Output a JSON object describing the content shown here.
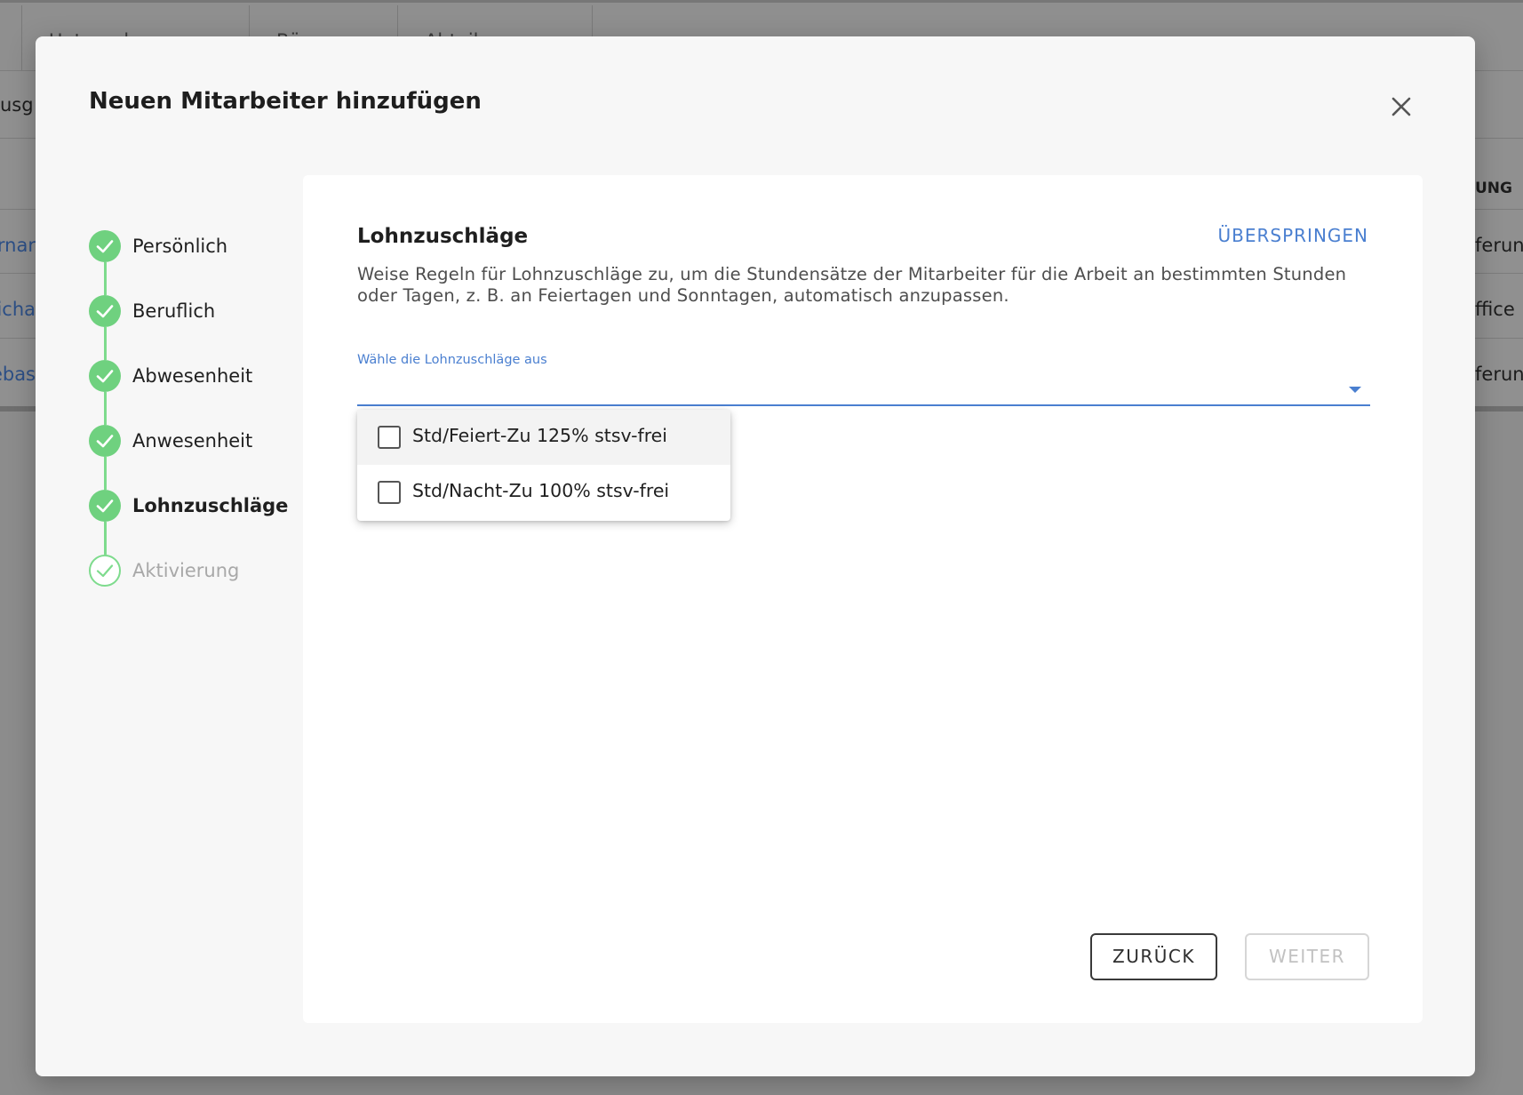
{
  "background": {
    "filters": [
      "Unternehmen",
      "Büro",
      "Abteilung"
    ],
    "left_fragments": [
      "usg",
      "rnar",
      "icha",
      "ebas"
    ],
    "right_fragments": [
      "UNG",
      "ferun",
      "ffice",
      "ferun"
    ]
  },
  "modal": {
    "title": "Neuen Mitarbeiter hinzufügen"
  },
  "stepper": {
    "steps": [
      {
        "label": "Persönlich",
        "state": "done"
      },
      {
        "label": "Beruflich",
        "state": "done"
      },
      {
        "label": "Abwesenheit",
        "state": "done"
      },
      {
        "label": "Anwesenheit",
        "state": "done"
      },
      {
        "label": "Lohnzuschläge",
        "state": "active"
      },
      {
        "label": "Aktivierung",
        "state": "pending"
      }
    ]
  },
  "content": {
    "title": "Lohnzuschläge",
    "skip_label": "ÜBERSPRINGEN",
    "description": "Weise Regeln für Lohnzuschläge zu, um die Stundensätze der Mitarbeiter für die Arbeit an bestimmten Stunden oder Tagen, z. B. an Feiertagen und Sonntagen, automatisch anzupassen.",
    "select_label": "Wähle die Lohnzuschläge aus",
    "options": [
      {
        "label": "Std/Feiert-Zu 125% stsv-frei",
        "checked": false
      },
      {
        "label": "Std/Nacht-Zu 100% stsv-frei",
        "checked": false
      }
    ]
  },
  "footer": {
    "back_label": "ZURÜCK",
    "next_label": "WEITER"
  },
  "colors": {
    "accent": "#4a7fd0",
    "success": "#6fd17f",
    "overlay": "#8c8c8c"
  }
}
